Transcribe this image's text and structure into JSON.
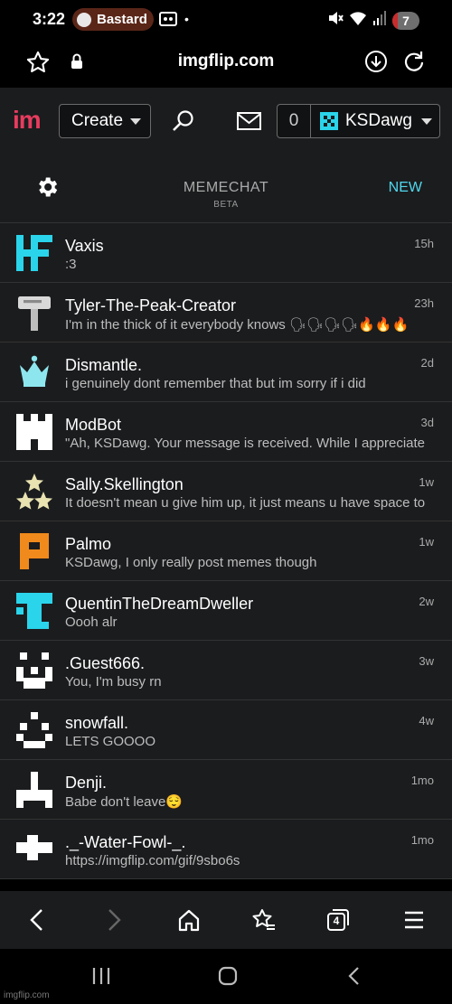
{
  "status": {
    "time": "3:22",
    "spotify_label": "Bastard",
    "dot": "•",
    "battery": "7",
    "battery_level_percent": 7
  },
  "browser": {
    "url": "imgflip.com"
  },
  "header": {
    "logo": "im",
    "create_label": "Create",
    "notif_count": "0",
    "username": "KSDawg"
  },
  "memechat": {
    "title": "MEMECHAT",
    "subtitle": "BETA",
    "new_label": "NEW"
  },
  "chats": [
    {
      "name": "Vaxis",
      "message": ":3",
      "time": "15h",
      "avatar": "hf-icon",
      "color": "#2ad4ea"
    },
    {
      "name": "Tyler-The-Peak-Creator",
      "message": "I'm in the thick of it everybody knows 🗣🗣🗣🗣🔥🔥🔥",
      "time": "23h",
      "avatar": "signpost-icon",
      "color": "#cfcfcf"
    },
    {
      "name": "Dismantle.",
      "message": "i genuinely dont remember that but im sorry if i did",
      "time": "2d",
      "avatar": "crown-icon",
      "color": "#8de6ee"
    },
    {
      "name": "ModBot",
      "message": "\"Ah, KSDawg. Your message is received. While I appreciate",
      "time": "3d",
      "avatar": "castle-icon",
      "color": "#ffffff"
    },
    {
      "name": "Sally.Skellington",
      "message": "It doesn't mean u give him up, it just means u have space to",
      "time": "1w",
      "avatar": "stars-icon",
      "color": "#e8e3b0"
    },
    {
      "name": "Palmo",
      "message": "KSDawg, I only really post memes though",
      "time": "1w",
      "avatar": "p-block-icon",
      "color": "#f08a1c"
    },
    {
      "name": "QuentinTheDreamDweller",
      "message": "Oooh alr",
      "time": "2w",
      "avatar": "t-block-icon",
      "color": "#2ad4ea"
    },
    {
      "name": ".Guest666.",
      "message": "You, I'm busy rn",
      "time": "3w",
      "avatar": "face-block-icon",
      "color": "#ffffff"
    },
    {
      "name": "snowfall.",
      "message": "LETS GOOOO",
      "time": "4w",
      "avatar": "smile-block-icon",
      "color": "#ffffff"
    },
    {
      "name": "Denji.",
      "message": "Babe don't leave😌",
      "time": "1mo",
      "avatar": "anchor-block-icon",
      "color": "#ffffff"
    },
    {
      "name": "._-Water-Fowl-_.",
      "message": "https://imgflip.com/gif/9sbo6s",
      "time": "1mo",
      "avatar": "cross-block-icon",
      "color": "#ffffff"
    }
  ],
  "bottom_bar": {
    "tabs_count": "4"
  },
  "watermark": "imgflip.com"
}
